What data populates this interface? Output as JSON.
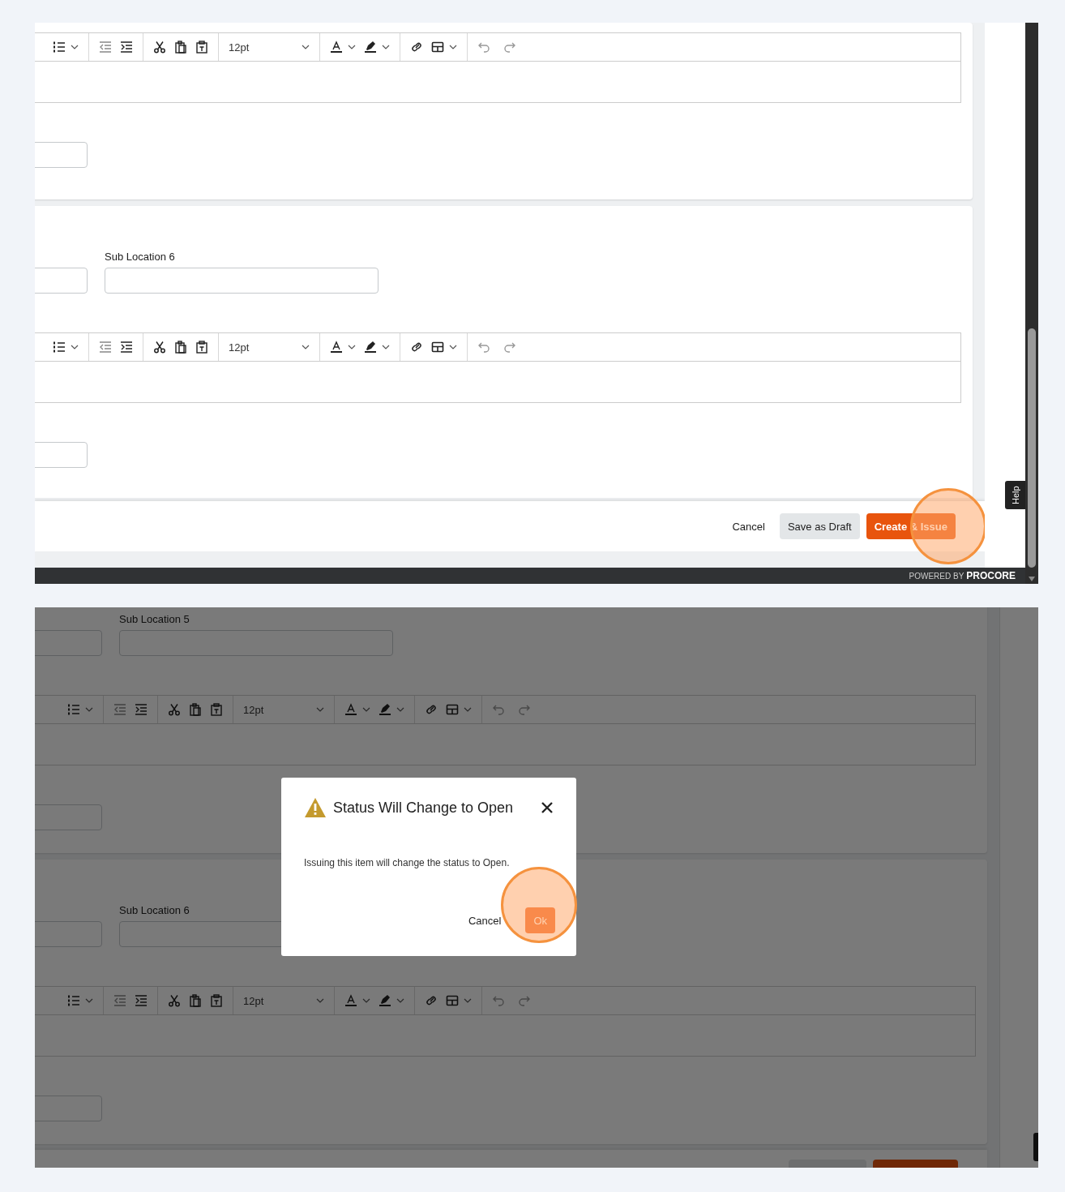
{
  "screens": [
    {
      "kind": "form",
      "cards": [
        {
          "editor": {
            "font_size": "12pt"
          }
        },
        {
          "field_label": "Sub Location 6",
          "editor": {
            "font_size": "12pt"
          }
        }
      ],
      "footer_buttons": [
        {
          "label": "Cancel",
          "kind": "link",
          "highlighted": false
        },
        {
          "label": "Save as Draft",
          "kind": "secondary",
          "highlighted": false
        },
        {
          "label": "Create & Issue",
          "kind": "primary",
          "highlighted": true
        }
      ],
      "help_tab": "Help",
      "powered_by": "POWERED BY",
      "brand": "PROCORE"
    },
    {
      "kind": "dialog_open",
      "cards": [
        {
          "field_label": "Sub Location 5",
          "editor": {
            "font_size": "12pt"
          }
        },
        {
          "field_label": "Sub Location 6",
          "editor": {
            "font_size": "12pt"
          }
        }
      ],
      "dialog": {
        "title": "Status Will Change to Open",
        "message": "Issuing this item will change the status to Open.",
        "buttons": [
          {
            "label": "Cancel",
            "kind": "link",
            "highlighted": false
          },
          {
            "label": "Ok",
            "kind": "primary",
            "highlighted": true
          }
        ]
      }
    }
  ]
}
